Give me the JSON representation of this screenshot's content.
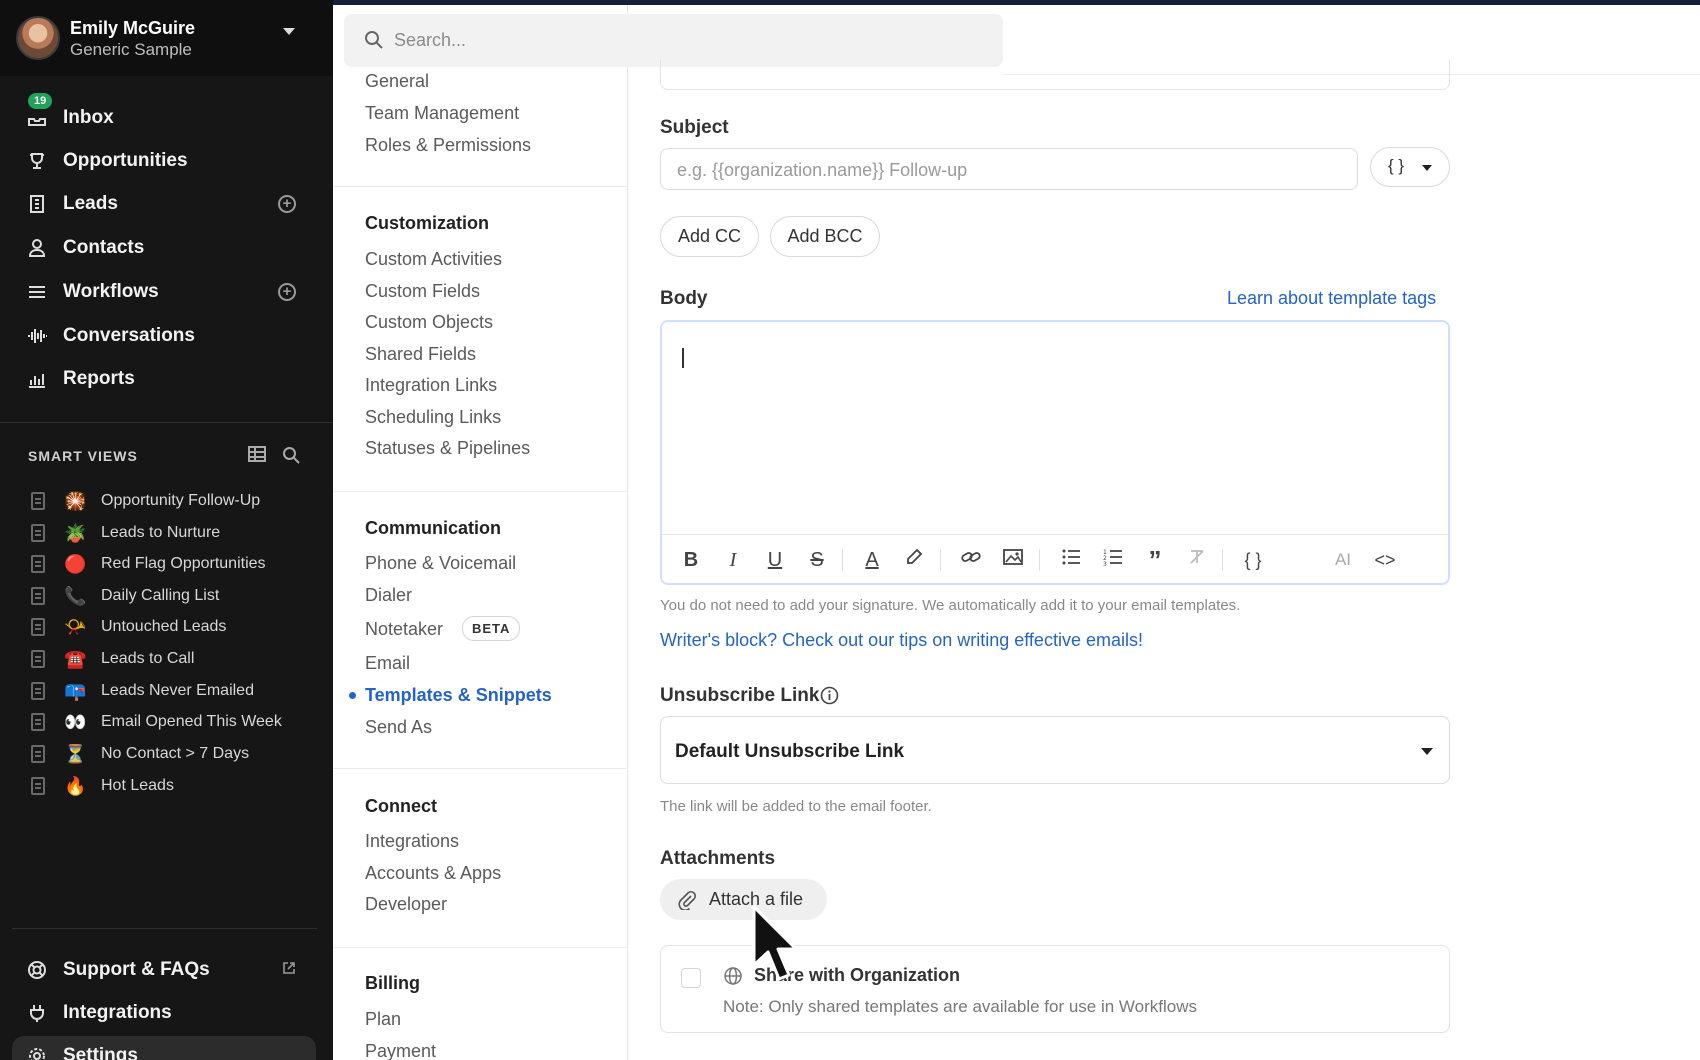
{
  "user": {
    "name": "Emily McGuire",
    "org": "Generic Sample"
  },
  "nav": {
    "inbox": {
      "label": "Inbox",
      "badge": "19"
    },
    "opportunities": "Opportunities",
    "leads": "Leads",
    "contacts": "Contacts",
    "workflows": "Workflows",
    "conversations": "Conversations",
    "reports": "Reports"
  },
  "smart_views": {
    "title": "SMART VIEWS",
    "items": [
      {
        "label": "Opportunity Follow-Up",
        "emoji": "🎇"
      },
      {
        "label": "Leads to Nurture",
        "emoji": "🪴"
      },
      {
        "label": "Red Flag Opportunities",
        "emoji": "🔴"
      },
      {
        "label": "Daily Calling List",
        "emoji": "📞"
      },
      {
        "label": "Untouched Leads",
        "emoji": "📯"
      },
      {
        "label": "Leads to Call",
        "emoji": "☎️"
      },
      {
        "label": "Leads Never Emailed",
        "emoji": "📪"
      },
      {
        "label": "Email Opened This Week",
        "emoji": "👀"
      },
      {
        "label": "No Contact > 7 Days",
        "emoji": "⏳"
      },
      {
        "label": "Hot Leads",
        "emoji": "🔥"
      }
    ]
  },
  "bottom_nav": {
    "support": "Support & FAQs",
    "integrations": "Integrations",
    "settings": "Settings"
  },
  "search": {
    "placeholder": "Search..."
  },
  "settings_menu": {
    "top_items": [
      "General",
      "Team Management",
      "Roles & Permissions"
    ],
    "customization": {
      "title": "Customization",
      "items": [
        "Custom Activities",
        "Custom Fields",
        "Custom Objects",
        "Shared Fields",
        "Integration Links",
        "Scheduling Links",
        "Statuses & Pipelines"
      ]
    },
    "communication": {
      "title": "Communication",
      "items": [
        "Phone & Voicemail",
        "Dialer",
        "Notetaker",
        "Email",
        "Templates & Snippets",
        "Send As"
      ],
      "beta": "BETA"
    },
    "connect": {
      "title": "Connect",
      "items": [
        "Integrations",
        "Accounts & Apps",
        "Developer"
      ]
    },
    "billing": {
      "title": "Billing",
      "items": [
        "Plan",
        "Payment"
      ]
    }
  },
  "form": {
    "subject_label": "Subject",
    "subject_placeholder": "e.g. {{organization.name}} Follow-up",
    "template_tag_btn": "{ }",
    "add_cc": "Add CC",
    "add_bcc": "Add BCC",
    "body_label": "Body",
    "template_tags_link": "Learn about template tags",
    "signature_note": "You do not need to add your signature. We automatically add it to your email templates.",
    "writers_block_link": "Writer's block? Check out our tips on writing effective emails!",
    "unsubscribe_label": "Unsubscribe Link",
    "unsubscribe_value": "Default Unsubscribe Link",
    "unsubscribe_help": "The link will be added to the email footer.",
    "attachments_label": "Attachments",
    "attach_button": "Attach a file",
    "share_label": "Share with Organization",
    "share_note": "Note: Only shared templates are available for use in Workflows",
    "toolbar_ai": "AI"
  }
}
